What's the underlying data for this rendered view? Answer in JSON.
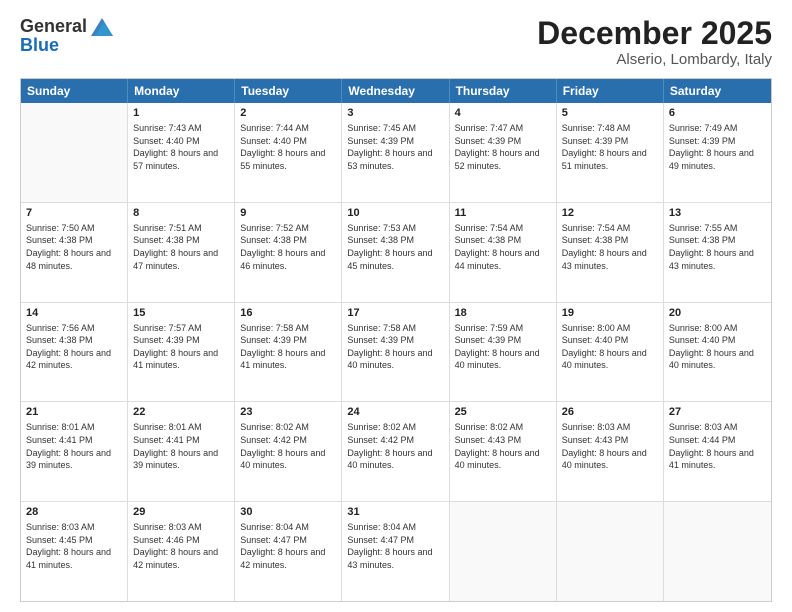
{
  "logo": {
    "general": "General",
    "blue": "Blue"
  },
  "header": {
    "month": "December 2025",
    "location": "Alserio, Lombardy, Italy"
  },
  "weekdays": [
    "Sunday",
    "Monday",
    "Tuesday",
    "Wednesday",
    "Thursday",
    "Friday",
    "Saturday"
  ],
  "rows": [
    [
      {
        "day": "",
        "sunrise": "",
        "sunset": "",
        "daylight": ""
      },
      {
        "day": "1",
        "sunrise": "Sunrise: 7:43 AM",
        "sunset": "Sunset: 4:40 PM",
        "daylight": "Daylight: 8 hours and 57 minutes."
      },
      {
        "day": "2",
        "sunrise": "Sunrise: 7:44 AM",
        "sunset": "Sunset: 4:40 PM",
        "daylight": "Daylight: 8 hours and 55 minutes."
      },
      {
        "day": "3",
        "sunrise": "Sunrise: 7:45 AM",
        "sunset": "Sunset: 4:39 PM",
        "daylight": "Daylight: 8 hours and 53 minutes."
      },
      {
        "day": "4",
        "sunrise": "Sunrise: 7:47 AM",
        "sunset": "Sunset: 4:39 PM",
        "daylight": "Daylight: 8 hours and 52 minutes."
      },
      {
        "day": "5",
        "sunrise": "Sunrise: 7:48 AM",
        "sunset": "Sunset: 4:39 PM",
        "daylight": "Daylight: 8 hours and 51 minutes."
      },
      {
        "day": "6",
        "sunrise": "Sunrise: 7:49 AM",
        "sunset": "Sunset: 4:39 PM",
        "daylight": "Daylight: 8 hours and 49 minutes."
      }
    ],
    [
      {
        "day": "7",
        "sunrise": "Sunrise: 7:50 AM",
        "sunset": "Sunset: 4:38 PM",
        "daylight": "Daylight: 8 hours and 48 minutes."
      },
      {
        "day": "8",
        "sunrise": "Sunrise: 7:51 AM",
        "sunset": "Sunset: 4:38 PM",
        "daylight": "Daylight: 8 hours and 47 minutes."
      },
      {
        "day": "9",
        "sunrise": "Sunrise: 7:52 AM",
        "sunset": "Sunset: 4:38 PM",
        "daylight": "Daylight: 8 hours and 46 minutes."
      },
      {
        "day": "10",
        "sunrise": "Sunrise: 7:53 AM",
        "sunset": "Sunset: 4:38 PM",
        "daylight": "Daylight: 8 hours and 45 minutes."
      },
      {
        "day": "11",
        "sunrise": "Sunrise: 7:54 AM",
        "sunset": "Sunset: 4:38 PM",
        "daylight": "Daylight: 8 hours and 44 minutes."
      },
      {
        "day": "12",
        "sunrise": "Sunrise: 7:54 AM",
        "sunset": "Sunset: 4:38 PM",
        "daylight": "Daylight: 8 hours and 43 minutes."
      },
      {
        "day": "13",
        "sunrise": "Sunrise: 7:55 AM",
        "sunset": "Sunset: 4:38 PM",
        "daylight": "Daylight: 8 hours and 43 minutes."
      }
    ],
    [
      {
        "day": "14",
        "sunrise": "Sunrise: 7:56 AM",
        "sunset": "Sunset: 4:38 PM",
        "daylight": "Daylight: 8 hours and 42 minutes."
      },
      {
        "day": "15",
        "sunrise": "Sunrise: 7:57 AM",
        "sunset": "Sunset: 4:39 PM",
        "daylight": "Daylight: 8 hours and 41 minutes."
      },
      {
        "day": "16",
        "sunrise": "Sunrise: 7:58 AM",
        "sunset": "Sunset: 4:39 PM",
        "daylight": "Daylight: 8 hours and 41 minutes."
      },
      {
        "day": "17",
        "sunrise": "Sunrise: 7:58 AM",
        "sunset": "Sunset: 4:39 PM",
        "daylight": "Daylight: 8 hours and 40 minutes."
      },
      {
        "day": "18",
        "sunrise": "Sunrise: 7:59 AM",
        "sunset": "Sunset: 4:39 PM",
        "daylight": "Daylight: 8 hours and 40 minutes."
      },
      {
        "day": "19",
        "sunrise": "Sunrise: 8:00 AM",
        "sunset": "Sunset: 4:40 PM",
        "daylight": "Daylight: 8 hours and 40 minutes."
      },
      {
        "day": "20",
        "sunrise": "Sunrise: 8:00 AM",
        "sunset": "Sunset: 4:40 PM",
        "daylight": "Daylight: 8 hours and 40 minutes."
      }
    ],
    [
      {
        "day": "21",
        "sunrise": "Sunrise: 8:01 AM",
        "sunset": "Sunset: 4:41 PM",
        "daylight": "Daylight: 8 hours and 39 minutes."
      },
      {
        "day": "22",
        "sunrise": "Sunrise: 8:01 AM",
        "sunset": "Sunset: 4:41 PM",
        "daylight": "Daylight: 8 hours and 39 minutes."
      },
      {
        "day": "23",
        "sunrise": "Sunrise: 8:02 AM",
        "sunset": "Sunset: 4:42 PM",
        "daylight": "Daylight: 8 hours and 40 minutes."
      },
      {
        "day": "24",
        "sunrise": "Sunrise: 8:02 AM",
        "sunset": "Sunset: 4:42 PM",
        "daylight": "Daylight: 8 hours and 40 minutes."
      },
      {
        "day": "25",
        "sunrise": "Sunrise: 8:02 AM",
        "sunset": "Sunset: 4:43 PM",
        "daylight": "Daylight: 8 hours and 40 minutes."
      },
      {
        "day": "26",
        "sunrise": "Sunrise: 8:03 AM",
        "sunset": "Sunset: 4:43 PM",
        "daylight": "Daylight: 8 hours and 40 minutes."
      },
      {
        "day": "27",
        "sunrise": "Sunrise: 8:03 AM",
        "sunset": "Sunset: 4:44 PM",
        "daylight": "Daylight: 8 hours and 41 minutes."
      }
    ],
    [
      {
        "day": "28",
        "sunrise": "Sunrise: 8:03 AM",
        "sunset": "Sunset: 4:45 PM",
        "daylight": "Daylight: 8 hours and 41 minutes."
      },
      {
        "day": "29",
        "sunrise": "Sunrise: 8:03 AM",
        "sunset": "Sunset: 4:46 PM",
        "daylight": "Daylight: 8 hours and 42 minutes."
      },
      {
        "day": "30",
        "sunrise": "Sunrise: 8:04 AM",
        "sunset": "Sunset: 4:47 PM",
        "daylight": "Daylight: 8 hours and 42 minutes."
      },
      {
        "day": "31",
        "sunrise": "Sunrise: 8:04 AM",
        "sunset": "Sunset: 4:47 PM",
        "daylight": "Daylight: 8 hours and 43 minutes."
      },
      {
        "day": "",
        "sunrise": "",
        "sunset": "",
        "daylight": ""
      },
      {
        "day": "",
        "sunrise": "",
        "sunset": "",
        "daylight": ""
      },
      {
        "day": "",
        "sunrise": "",
        "sunset": "",
        "daylight": ""
      }
    ]
  ]
}
